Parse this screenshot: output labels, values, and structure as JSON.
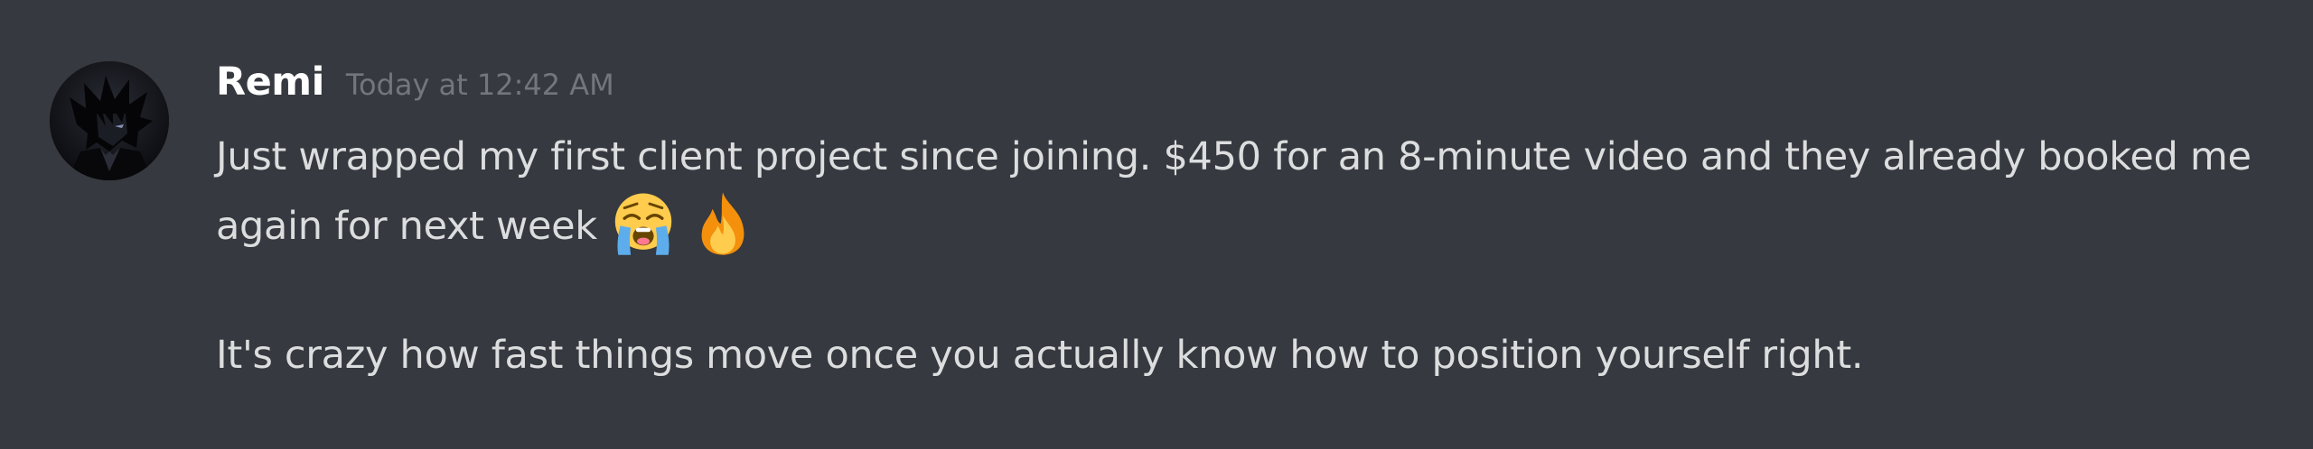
{
  "message": {
    "author": "Remi",
    "timestamp": "Today at 12:42 AM",
    "lines": [
      "Just wrapped my first client project since joining. $450 for an 8-minute video and they already booked me",
      "again for next week",
      "It's crazy how fast things move once you actually know how to position yourself right."
    ],
    "emojis": [
      "loudly-crying-face-emoji",
      "fire-emoji"
    ]
  },
  "colors": {
    "background": "#36393f",
    "username": "#ffffff",
    "timestamp": "#72767d",
    "text": "#dcddde"
  }
}
